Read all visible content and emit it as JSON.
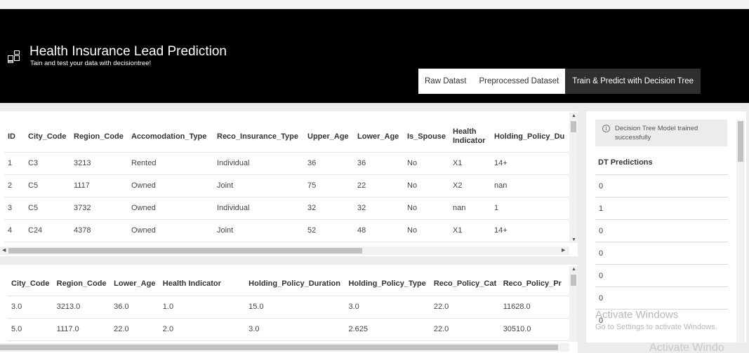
{
  "app": {
    "title": "Health Insurance Lead Prediction",
    "subtitle": "Tain and test your data with decisiontree!"
  },
  "tabs": [
    {
      "label": "Raw Datast",
      "active": false
    },
    {
      "label": "Preprocessed Dataset",
      "active": false
    },
    {
      "label": "Train & Predict with Decision Tree",
      "active": true
    }
  ],
  "raw_table": {
    "headers": [
      "ID",
      "City_Code",
      "Region_Code",
      "Accomodation_Type",
      "Reco_Insurance_Type",
      "Upper_Age",
      "Lower_Age",
      "Is_Spouse",
      "Health Indicator",
      "Holding_Policy_Du"
    ],
    "rows": [
      [
        "1",
        "C3",
        "3213",
        "Rented",
        "Individual",
        "36",
        "36",
        "No",
        "X1",
        "14+"
      ],
      [
        "2",
        "C5",
        "1117",
        "Owned",
        "Joint",
        "75",
        "22",
        "No",
        "X2",
        "nan"
      ],
      [
        "3",
        "C5",
        "3732",
        "Owned",
        "Individual",
        "32",
        "32",
        "No",
        "nan",
        "1"
      ],
      [
        "4",
        "C24",
        "4378",
        "Owned",
        "Joint",
        "52",
        "48",
        "No",
        "X1",
        "14+"
      ]
    ]
  },
  "processed_table": {
    "headers": [
      "City_Code",
      "Region_Code",
      "Lower_Age",
      "Health Indicator",
      "Holding_Policy_Duration",
      "Holding_Policy_Type",
      "Reco_Policy_Cat",
      "Reco_Policy_Pr"
    ],
    "rows": [
      [
        "3.0",
        "3213.0",
        "36.0",
        "1.0",
        "15.0",
        "3.0",
        "22.0",
        "11628.0"
      ],
      [
        "5.0",
        "1117.0",
        "22.0",
        "2.0",
        "3.0",
        "2.625",
        "22.0",
        "30510.0"
      ]
    ]
  },
  "info": {
    "icon": "info-icon",
    "message": "Decision Tree Model trained successfully"
  },
  "predictions": {
    "header": "DT Predictions",
    "values": [
      "0",
      "1",
      "0",
      "0",
      "0",
      "0",
      "0"
    ]
  },
  "watermark": {
    "line1": "Activate Windows",
    "line2": "Go to Settings to activate Windows.",
    "line3": "Activate Windo"
  },
  "colors": {
    "header_bg": "#000000",
    "active_tab_bg": "#2f2f2f",
    "page_bg": "#ececec"
  }
}
